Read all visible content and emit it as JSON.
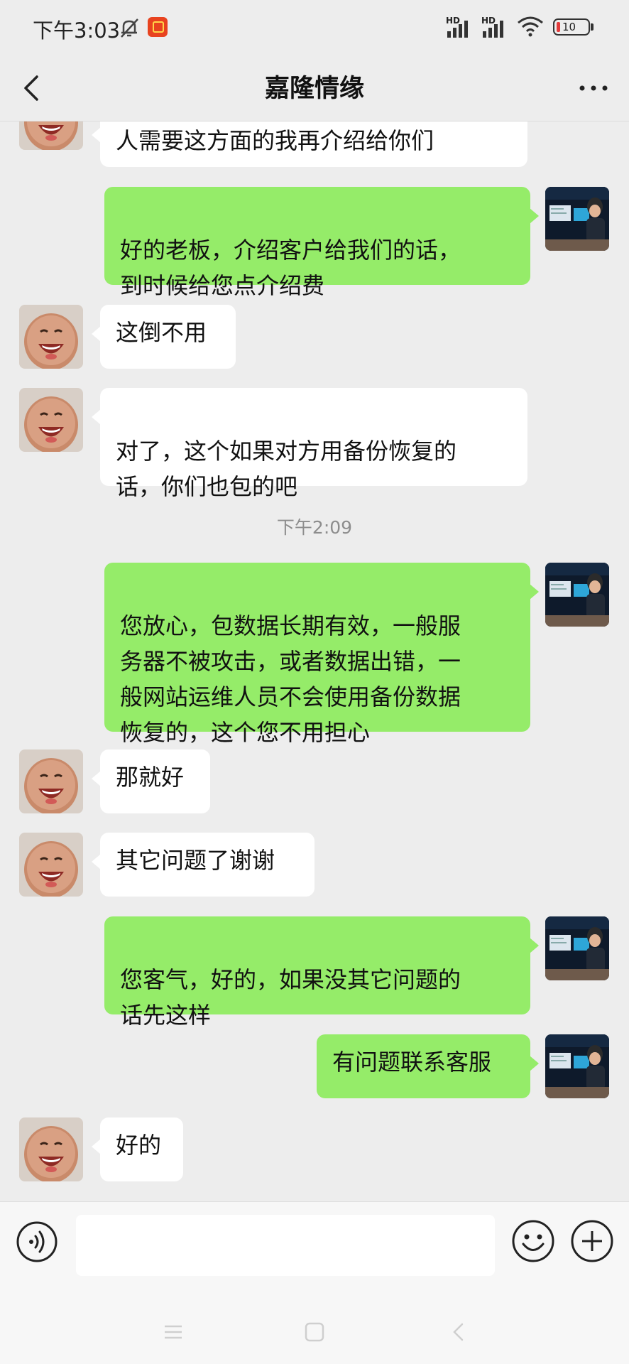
{
  "status_bar": {
    "time": "下午3:03",
    "hd1": "HD",
    "hd2": "HD",
    "battery": "10"
  },
  "header": {
    "title": "嘉隆情缘"
  },
  "messages": [
    {
      "side": "left",
      "text": "人需要这方面的我再介绍给你们"
    },
    {
      "side": "right",
      "text": "好的老板，介绍客户给我们的话，\n到时候给您点介绍费"
    },
    {
      "side": "left",
      "text": "这倒不用"
    },
    {
      "side": "left",
      "text": "对了，这个如果对方用备份恢复的\n话，你们也包的吧"
    },
    {
      "side": "right",
      "text": "您放心，包数据长期有效，一般服\n务器不被攻击，或者数据出错，一\n般网站运维人员不会使用备份数据\n恢复的，这个您不用担心"
    },
    {
      "side": "left",
      "text": "那就好"
    },
    {
      "side": "left",
      "text": "其它问题了谢谢"
    },
    {
      "side": "right",
      "text": "您客气，好的，如果没其它问题的\n话先这样"
    },
    {
      "side": "right",
      "text": "有问题联系客服"
    },
    {
      "side": "left",
      "text": "好的"
    }
  ],
  "timestamp": "下午2:09",
  "input": {
    "value": "",
    "placeholder": ""
  },
  "icons": {
    "back": "chevron-left-icon",
    "more": "more-dots-icon",
    "voice": "voice-icon",
    "emoji": "emoji-icon",
    "plus": "plus-icon"
  },
  "colors": {
    "self_bubble": "#95ec69",
    "other_bubble": "#ffffff",
    "background": "#ededed"
  }
}
